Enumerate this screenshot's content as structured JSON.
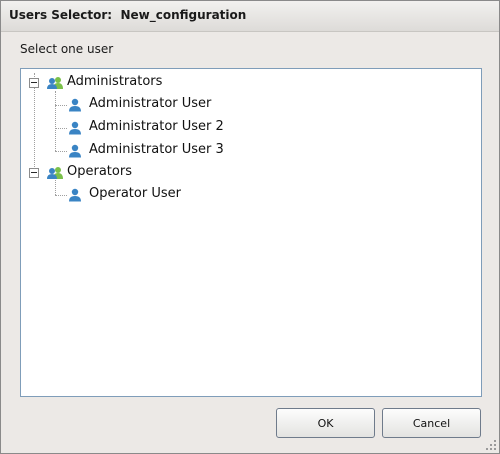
{
  "window": {
    "title": "Users Selector:  New_configuration"
  },
  "prompt": "Select one user",
  "tree": {
    "groups": [
      {
        "label": "Administrators",
        "expanded": true,
        "users": [
          "Administrator User",
          "Administrator User 2",
          "Administrator User 3"
        ]
      },
      {
        "label": "Operators",
        "expanded": true,
        "users": [
          "Operator User"
        ]
      }
    ]
  },
  "buttons": {
    "ok": "OK",
    "cancel": "Cancel"
  },
  "colors": {
    "user_icon": "#3a84c4",
    "group_icon_front": "#3a84c4",
    "group_icon_back": "#7ac04a",
    "accent_border": "#7f9db9"
  },
  "icons": {
    "user": "user-icon",
    "group": "user-group-icon",
    "collapse": "collapse-minus-icon"
  }
}
